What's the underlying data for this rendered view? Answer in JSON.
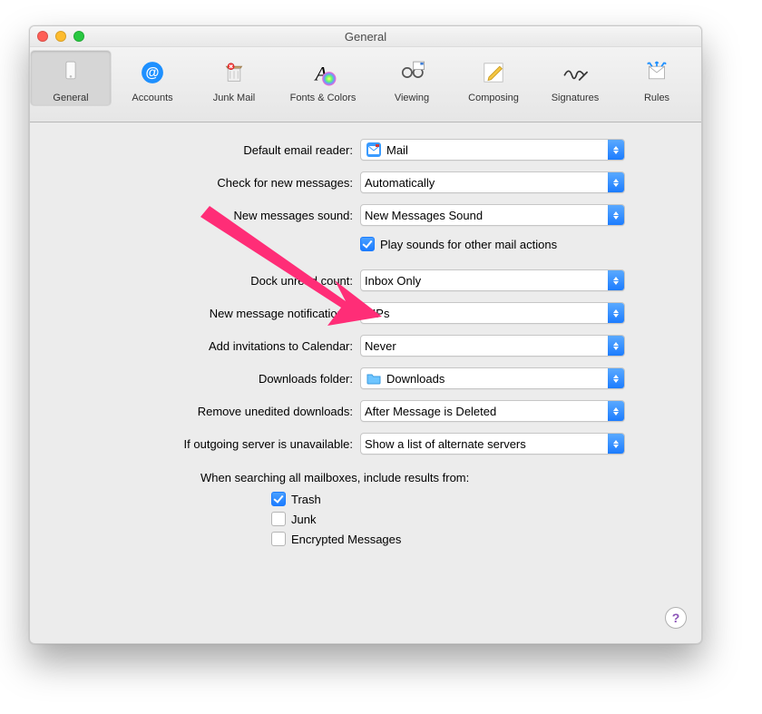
{
  "window": {
    "title": "General"
  },
  "toolbar": {
    "tabs": [
      {
        "label": "General"
      },
      {
        "label": "Accounts"
      },
      {
        "label": "Junk Mail"
      },
      {
        "label": "Fonts & Colors"
      },
      {
        "label": "Viewing"
      },
      {
        "label": "Composing"
      },
      {
        "label": "Signatures"
      },
      {
        "label": "Rules"
      }
    ]
  },
  "settings": {
    "default_reader": {
      "label": "Default email reader:",
      "value": "Mail"
    },
    "check_messages": {
      "label": "Check for new messages:",
      "value": "Automatically"
    },
    "new_sound": {
      "label": "New messages sound:",
      "value": "New Messages Sound"
    },
    "play_sounds": {
      "label": "Play sounds for other mail actions",
      "checked": true
    },
    "dock_unread": {
      "label": "Dock unread count:",
      "value": "Inbox Only"
    },
    "notifications": {
      "label": "New message notifications:",
      "value": "VIPs"
    },
    "invitations": {
      "label": "Add invitations to Calendar:",
      "value": "Never"
    },
    "downloads_folder": {
      "label": "Downloads folder:",
      "value": "Downloads"
    },
    "remove_downloads": {
      "label": "Remove unedited downloads:",
      "value": "After Message is Deleted"
    },
    "outgoing_server": {
      "label": "If outgoing server is unavailable:",
      "value": "Show a list of alternate servers"
    }
  },
  "search": {
    "header": "When searching all mailboxes, include results from:",
    "trash": {
      "label": "Trash",
      "checked": true
    },
    "junk": {
      "label": "Junk",
      "checked": false
    },
    "encrypted": {
      "label": "Encrypted Messages",
      "checked": false
    }
  },
  "help": "?"
}
